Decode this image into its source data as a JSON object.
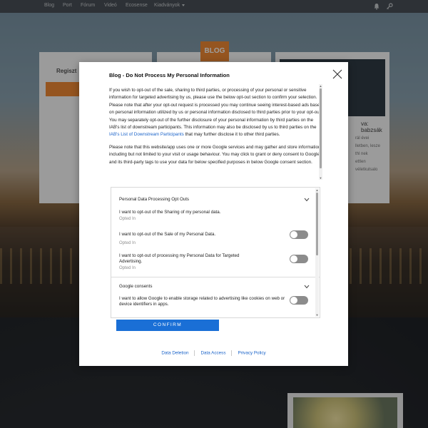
{
  "nav": {
    "items": [
      "Blog",
      "Port",
      "Fórum",
      "Videó",
      "Ecosense",
      "Kiadványok"
    ]
  },
  "background": {
    "register_label": "Regiszt",
    "logo_text": "BLOG",
    "card3_title": "va: babzsák",
    "card3_lines": [
      "rál évei",
      "lletben, lesze",
      "thl nek",
      "ettlen",
      "véletkulsalo"
    ]
  },
  "modal": {
    "title": "Blog - Do Not Process My Personal Information",
    "para1": "If you wish to opt-out of the sale, sharing to third parties, or processing of your personal or sensitive information for targeted advertising by us, please use the below opt-out section to confirm your selection. Please note that after your opt-out request is processed you may continue seeing interest-based ads based on personal information utilized by us or personal information disclosed to third parties prior to your opt-out. You may separately opt-out of the further disclosure of your personal information by third parties on the IAB's list of downstream participants. This information may also be disclosed by us to third parties on the",
    "iab_link": "IAB's List of Downstream Participants",
    "para1_end": "that may further disclose it to other third parties.",
    "para2": "Please note that this website/app uses one or more Google services and may gather and store information including but not limited to your visit or usage behaviour. You may click to grant or deny consent to Google and its third-party tags to use your data for below specified purposes in below Google consent section.",
    "section1": "Personal Data Processing Opt Outs",
    "opt1_label": "I want to opt-out of the Sharing of my personal data.",
    "opt1_status": "Opted In",
    "opt2_label": "I want to opt-out of the Sale of my Personal Data.",
    "opt2_status": "Opted In",
    "opt3_label": "I want to opt-out of processing my Personal Data for Targeted Advertising.",
    "opt3_status": "Opted In",
    "section2": "Google consents",
    "opt4_label": "I want to allow Google to enable storage related to advertising like cookies on web or device identifiers in apps.",
    "confirm_label": "CONFIRM",
    "footer": {
      "data_deletion": "Data Deletion",
      "data_access": "Data Access",
      "privacy_policy": "Privacy Policy"
    }
  },
  "colors": {
    "accent": "#1a6fd6",
    "link": "#1a63c9",
    "brand_orange": "#f08a34",
    "toggle_off": "#8c8c8c"
  }
}
